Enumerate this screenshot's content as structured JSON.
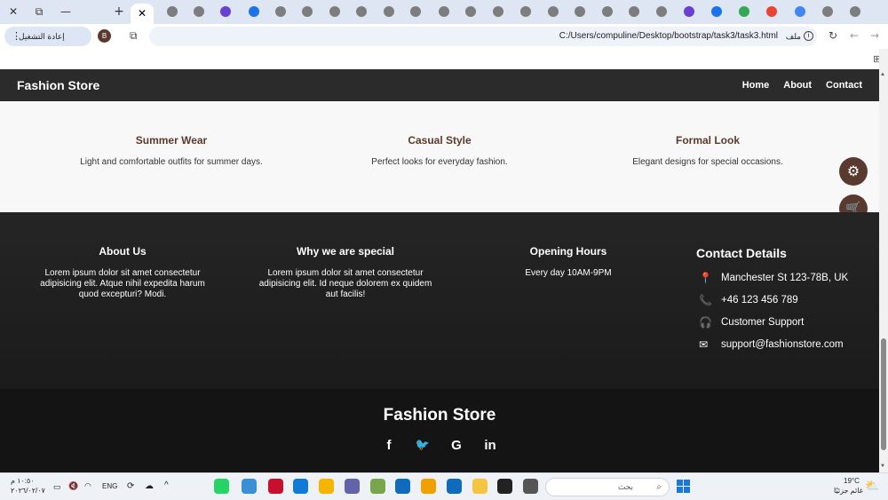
{
  "browser": {
    "active_tab_close": "✕",
    "window_controls": [
      "✕",
      "⧉",
      "—"
    ],
    "new_tab": "+",
    "reload_pill_label": "إعادة التشغيل للتحديث",
    "avatar_letter": "B",
    "url": "C:/Users/compuline/Desktop/bootstrap/task3/task3.html",
    "url_label": "ملف"
  },
  "navbar": {
    "brand": "Fashion Store",
    "links": [
      "Home",
      "About",
      "Contact"
    ]
  },
  "categories": [
    {
      "title": "Summer Wear",
      "text": "Light and comfortable outfits for summer days."
    },
    {
      "title": "Casual Style",
      "text": "Perfect looks for everyday fashion."
    },
    {
      "title": "Formal Look",
      "text": "Elegant designs for special occasions."
    }
  ],
  "floating_buttons": [
    {
      "icon": "gear-icon",
      "glyph": "⚙"
    },
    {
      "icon": "cart-icon",
      "glyph": "🛒"
    }
  ],
  "footer": {
    "about": {
      "title": "About Us",
      "text": "Lorem ipsum dolor sit amet consectetur adipisicing elit. Atque nihil expedita harum quod excepturi? Modi."
    },
    "special": {
      "title": "Why we are special",
      "text": "Lorem ipsum dolor sit amet consectetur adipisicing elit. Id neque dolorem ex quidem aut facilis!"
    },
    "hours": {
      "title": "Opening Hours",
      "text": "Every day 10AM-9PM"
    },
    "contact": {
      "title": "Contact Details",
      "items": [
        {
          "icon": "location-pin-icon",
          "glyph": "📍",
          "text": "Manchester St 123-78B, UK"
        },
        {
          "icon": "phone-icon",
          "glyph": "📞",
          "text": "+46 123 456 789"
        },
        {
          "icon": "headset-icon",
          "glyph": "🎧",
          "text": "Customer Support"
        },
        {
          "icon": "envelope-icon",
          "glyph": "✉",
          "text": "support@fashionstore.com"
        }
      ]
    }
  },
  "bottom": {
    "brand": "Fashion Store",
    "socials": [
      {
        "icon": "facebook-icon",
        "glyph": "f"
      },
      {
        "icon": "twitter-icon",
        "glyph": "🐦"
      },
      {
        "icon": "google-icon",
        "glyph": "G"
      },
      {
        "icon": "linkedin-icon",
        "glyph": "in"
      }
    ]
  },
  "taskbar": {
    "time": "١٠:٥٠ م",
    "date": "٢٠٢٦/٠٢/٠٧",
    "lang": "ENG",
    "search_placeholder": "بحث",
    "weather_temp": "19°C",
    "weather_desc": "غائم جزئيًا"
  },
  "colors": {
    "accent": "#5a3a2e",
    "footer_bg": "#222222",
    "navbar_bg": "#2b2b2b"
  }
}
